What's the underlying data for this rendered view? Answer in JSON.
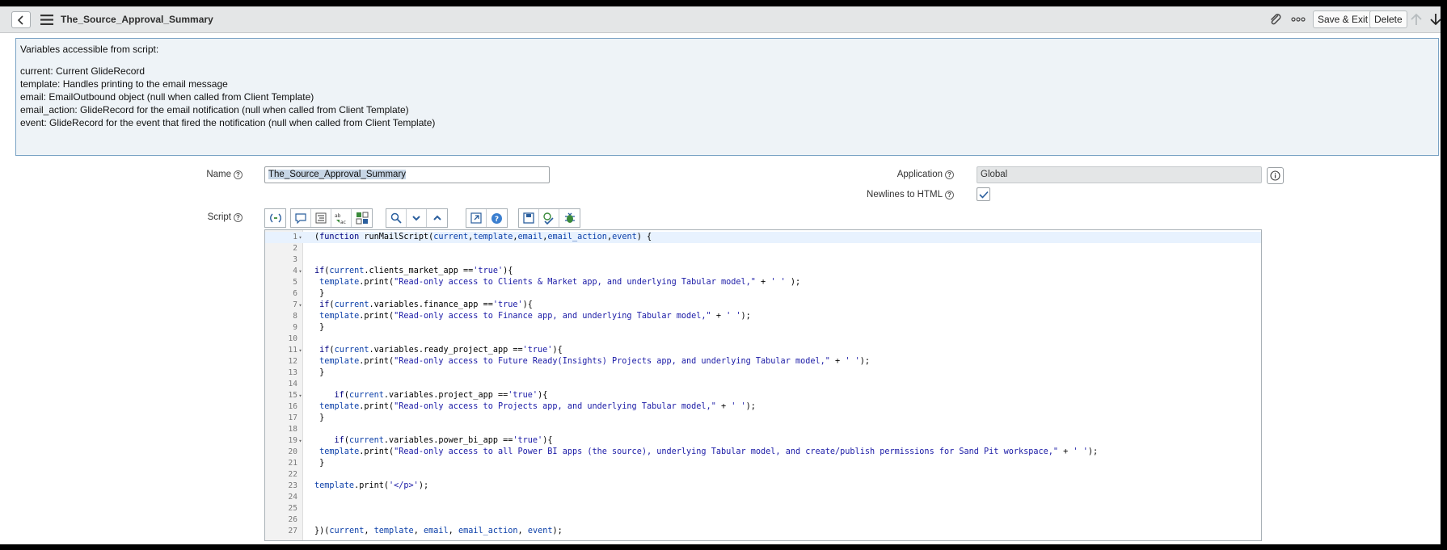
{
  "header": {
    "title": "The_Source_Approval_Summary",
    "save_exit_label": "Save & Exit",
    "delete_label": "Delete"
  },
  "info_banner": {
    "heading": "Variables accessible from script:",
    "lines": [
      "current: Current GlideRecord",
      "template: Handles printing to the email message",
      "email: EmailOutbound object (null when called from Client Template)",
      "email_action: GlideRecord for the email notification (null when called from Client Template)",
      "event: GlideRecord for the event that fired the notification (null when called from Client Template)"
    ]
  },
  "form": {
    "name_label": "Name",
    "name_value": "The_Source_Approval_Summary",
    "application_label": "Application",
    "application_value": "Global",
    "newlines_label": "Newlines to HTML",
    "newlines_checked": true,
    "script_label": "Script"
  },
  "toolbar_icons": [
    "toggle-syntax-icon",
    "comment-icon",
    "format-icon",
    "replace-icon",
    "replace-all-icon",
    "search-icon",
    "collapse-icon",
    "expand-icon",
    "fullscreen-icon",
    "help-icon",
    "save-icon",
    "check-syntax-icon",
    "debug-icon"
  ],
  "script": {
    "lines": [
      "(function runMailScript(current,template,email,email_action,event) {",
      "",
      "",
      "if(current.clients_market_app =='true'){",
      " template.print(\"Read-only access to Clients & Market app, and underlying Tabular model,\" + ' ' );",
      " }",
      " if(current.variables.finance_app =='true'){",
      " template.print(\"Read-only access to Finance app, and underlying Tabular model,\" + ' ');",
      " }",
      "",
      " if(current.variables.ready_project_app =='true'){",
      " template.print(\"Read-only access to Future Ready(Insights) Projects app, and underlying Tabular model,\" + ' ');",
      " }",
      "",
      "    if(current.variables.project_app =='true'){",
      " template.print(\"Read-only access to Projects app, and underlying Tabular model,\" + ' ');",
      " }",
      "",
      "    if(current.variables.power_bi_app =='true'){",
      " template.print(\"Read-only access to all Power BI apps (the source), underlying Tabular model, and create/publish permissions for Sand Pit workspace,\" + ' ');",
      " }",
      "",
      "template.print('</p>');",
      "",
      "",
      "",
      "})(current, template, email, email_action, event);"
    ],
    "fold_lines": [
      1,
      4,
      7,
      11,
      15,
      19
    ]
  }
}
